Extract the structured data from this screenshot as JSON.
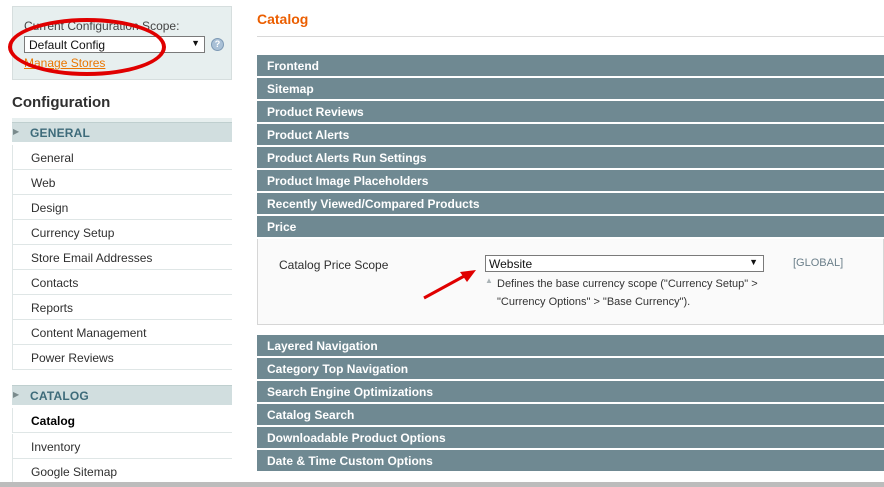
{
  "scope": {
    "label": "Current Configuration Scope:",
    "selected": "Default Config",
    "help_icon": "help-icon",
    "manage_stores": "Manage Stores"
  },
  "sidebar": {
    "title": "Configuration",
    "general_section": {
      "label": "GENERAL",
      "items": [
        "General",
        "Web",
        "Design",
        "Currency Setup",
        "Store Email Addresses",
        "Contacts",
        "Reports",
        "Content Management",
        "Power Reviews"
      ]
    },
    "catalog_section": {
      "label": "CATALOG",
      "items": [
        "Catalog",
        "Inventory",
        "Google Sitemap"
      ],
      "active": "Catalog"
    }
  },
  "main": {
    "title": "Catalog",
    "groups_top": [
      "Frontend",
      "Sitemap",
      "Product Reviews",
      "Product Alerts",
      "Product Alerts Run Settings",
      "Product Image Placeholders",
      "Recently Viewed/Compared Products",
      "Price"
    ],
    "price": {
      "field_label": "Catalog Price Scope",
      "value": "Website",
      "scope": "[GLOBAL]",
      "note_line1": "Defines the base currency scope (\"Currency Setup\" >",
      "note_line2": "\"Currency Options\" > \"Base Currency\")."
    },
    "groups_bottom": [
      "Layered Navigation",
      "Category Top Navigation",
      "Search Engine Optimizations",
      "Catalog Search",
      "Downloadable Product Options",
      "Date & Time Custom Options"
    ]
  },
  "colors": {
    "accent_orange": "#eb5e00",
    "bar_bg": "#6f8992",
    "annotation_red": "#e00000"
  }
}
